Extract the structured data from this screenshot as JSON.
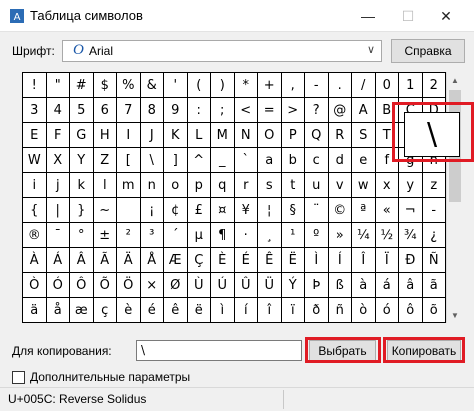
{
  "window": {
    "title": "Таблица символов",
    "controls": {
      "minimize": "—",
      "maximize": "☐",
      "close": "✕"
    }
  },
  "font_selector": {
    "label": "Шрифт:",
    "value": "Arial",
    "icon_glyph": "O",
    "arrow": "∨",
    "help_button": "Справка"
  },
  "character_grid": {
    "rows": [
      [
        "!",
        "\"",
        "#",
        "$",
        "%",
        "&",
        "'",
        "(",
        ")",
        "*",
        "+",
        ",",
        "-",
        ".",
        "/",
        "0",
        "1",
        "2"
      ],
      [
        "3",
        "4",
        "5",
        "6",
        "7",
        "8",
        "9",
        ":",
        ";",
        "<",
        "=",
        ">",
        "?",
        "@",
        "A",
        "B",
        "C",
        "D"
      ],
      [
        "E",
        "F",
        "G",
        "H",
        "I",
        "J",
        "K",
        "L",
        "M",
        "N",
        "O",
        "P",
        "Q",
        "R",
        "S",
        "T",
        "U",
        ""
      ],
      [
        "W",
        "X",
        "Y",
        "Z",
        "[",
        "\\",
        "]",
        "^",
        "_",
        "`",
        "a",
        "b",
        "c",
        "d",
        "e",
        "f",
        "g",
        "h"
      ],
      [
        "i",
        "j",
        "k",
        "l",
        "m",
        "n",
        "o",
        "p",
        "q",
        "r",
        "s",
        "t",
        "u",
        "v",
        "w",
        "x",
        "y",
        "z"
      ],
      [
        "{",
        "|",
        "}",
        "~",
        "",
        "¡",
        "¢",
        "£",
        "¤",
        "¥",
        "¦",
        "§",
        "¨",
        "©",
        "ª",
        "«",
        "¬",
        "-"
      ],
      [
        "®",
        "¯",
        "°",
        "±",
        "²",
        "³",
        "´",
        "µ",
        "¶",
        "·",
        "¸",
        "¹",
        "º",
        "»",
        "¼",
        "½",
        "¾",
        "¿"
      ],
      [
        "À",
        "Á",
        "Â",
        "Ã",
        "Ä",
        "Å",
        "Æ",
        "Ç",
        "È",
        "É",
        "Ê",
        "Ë",
        "Ì",
        "Í",
        "Î",
        "Ï",
        "Ð",
        "Ñ"
      ],
      [
        "Ò",
        "Ó",
        "Ô",
        "Õ",
        "Ö",
        "×",
        "Ø",
        "Ù",
        "Ú",
        "Û",
        "Ü",
        "Ý",
        "Þ",
        "ß",
        "à",
        "á",
        "â",
        "ã"
      ],
      [
        "ä",
        "å",
        "æ",
        "ç",
        "è",
        "é",
        "ê",
        "ë",
        "ì",
        "í",
        "î",
        "ï",
        "ð",
        "ñ",
        "ò",
        "ó",
        "ô",
        "õ"
      ]
    ],
    "zoomed_char": "\\",
    "scroll_up": "▲",
    "scroll_down": "▼"
  },
  "copy_section": {
    "label": "Для копирования:",
    "value": "\\",
    "select_button": "Выбрать",
    "copy_button": "Копировать"
  },
  "advanced": {
    "label": "Дополнительные параметры",
    "checked": false
  },
  "status": {
    "text": "U+005C: Reverse Solidus"
  },
  "colors": {
    "highlight": "#e01b24",
    "font_icon": "#1a57a8"
  }
}
